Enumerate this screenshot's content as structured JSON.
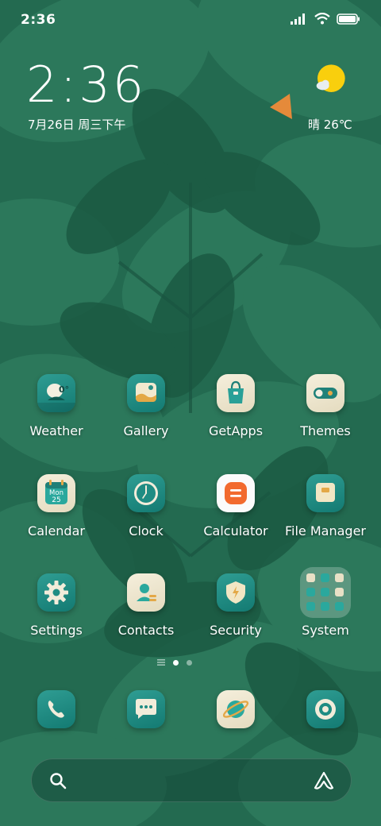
{
  "status_bar": {
    "time": "2:36",
    "icons": [
      "signal-icon",
      "wifi-icon",
      "battery-icon"
    ]
  },
  "clock_widget": {
    "time": "2:36",
    "date": "7月26日 周三下午"
  },
  "weather_widget": {
    "icon": "partly-sunny-icon",
    "text": "晴 26℃"
  },
  "apps": [
    {
      "label": "Weather",
      "icon": "weather-icon"
    },
    {
      "label": "Gallery",
      "icon": "gallery-icon"
    },
    {
      "label": "GetApps",
      "icon": "getapps-icon"
    },
    {
      "label": "Themes",
      "icon": "themes-icon"
    },
    {
      "label": "Calendar",
      "icon": "calendar-icon",
      "icon_text_top": "Mon",
      "icon_text_bottom": "25"
    },
    {
      "label": "Clock",
      "icon": "clock-icon"
    },
    {
      "label": "Calculator",
      "icon": "calculator-icon"
    },
    {
      "label": "File Manager",
      "icon": "file-manager-icon"
    },
    {
      "label": "Settings",
      "icon": "settings-icon"
    },
    {
      "label": "Contacts",
      "icon": "contacts-icon"
    },
    {
      "label": "Security",
      "icon": "security-icon"
    },
    {
      "label": "System",
      "icon": "folder-icon"
    }
  ],
  "weather_icon_text": "0°",
  "page_indicator": {
    "pages": 2,
    "current": 1
  },
  "dock": [
    {
      "icon": "phone-icon"
    },
    {
      "icon": "messages-icon"
    },
    {
      "icon": "browser-icon"
    },
    {
      "icon": "camera-icon"
    }
  ],
  "search_bar": {
    "left_icon": "search-icon",
    "right_icon": "assistant-icon"
  },
  "colors": {
    "wallpaper": "#22684e",
    "icon_teal": "#1f8c83",
    "icon_cream": "#efe8d2",
    "accent_orange": "#f26a2e",
    "sun_yellow": "#f9cf0d"
  }
}
